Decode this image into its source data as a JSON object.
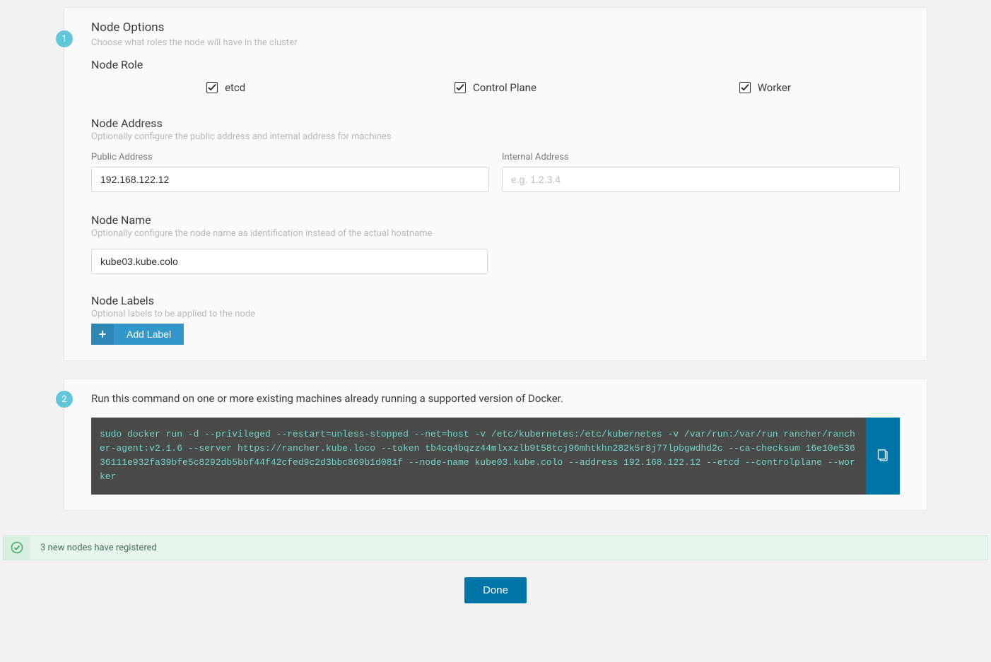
{
  "step1": {
    "num": "1",
    "title": "Node Options",
    "subtitle": "Choose what roles the node will have in the cluster",
    "role": {
      "heading": "Node Role",
      "etcd": "etcd",
      "control_plane": "Control Plane",
      "worker": "Worker"
    },
    "address": {
      "heading": "Node Address",
      "subtitle": "Optionally configure the public address and internal address for machines",
      "public_label": "Public Address",
      "public_value": "192.168.122.12",
      "internal_label": "Internal Address",
      "internal_placeholder": "e.g. 1.2.3.4"
    },
    "name": {
      "heading": "Node Name",
      "subtitle": "Optionally configure the node name as identification instead of the actual hostname",
      "value": "kube03.kube.colo"
    },
    "labels": {
      "heading": "Node Labels",
      "subtitle": "Optional labels to be applied to the node",
      "add_label": "Add Label"
    }
  },
  "step2": {
    "num": "2",
    "intro": "Run this command on one or more existing machines already running a supported version of Docker.",
    "command": "sudo docker run -d --privileged --restart=unless-stopped --net=host -v /etc/kubernetes:/etc/kubernetes -v /var/run:/var/run rancher/rancher-agent:v2.1.6 --server https://rancher.kube.loco --token tb4cq4bqzz44mlxxzlb9t58tcj96mhtkhn282k5r8j77lpbgwdhd2c --ca-checksum 16e10e53636111e932fa39bfe5c8292db5bbf44f42cfed9c2d3bbc869b1d081f --node-name kube03.kube.colo --address 192.168.122.12 --etcd --controlplane --worker"
  },
  "notice": "3 new nodes have registered",
  "done": "Done"
}
